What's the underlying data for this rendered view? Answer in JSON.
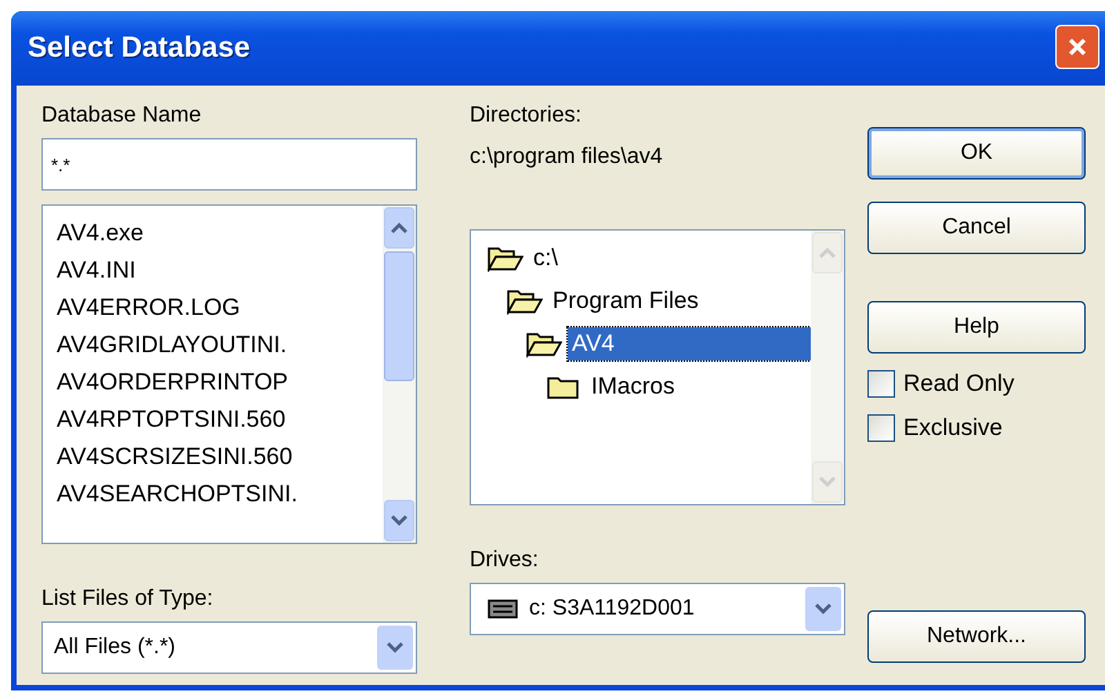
{
  "window": {
    "title": "Select Database"
  },
  "database_name": {
    "label": "Database Name",
    "value": "*.*"
  },
  "files": [
    "AV4.exe",
    "AV4.INI",
    "AV4ERROR.LOG",
    "AV4GRIDLAYOUTINI.",
    "AV4ORDERPRINTOP",
    "AV4RPTOPTSINI.560",
    "AV4SCRSIZESINI.560",
    "AV4SEARCHOPTSINI."
  ],
  "file_type": {
    "label": "List Files of Type:",
    "value": "All Files (*.*)"
  },
  "directories": {
    "label": "Directories:",
    "path": "c:\\program files\\av4",
    "tree": [
      {
        "label": "c:\\",
        "expanded": true,
        "selected": false,
        "children": [
          {
            "label": "Program Files",
            "expanded": true,
            "selected": false,
            "children": [
              {
                "label": "AV4",
                "expanded": true,
                "selected": true,
                "children": [
                  {
                    "label": "IMacros",
                    "expanded": false,
                    "selected": false
                  }
                ]
              }
            ]
          }
        ]
      }
    ]
  },
  "drives": {
    "label": "Drives:",
    "value": "c: S3A1192D001"
  },
  "buttons": [
    {
      "label": "OK",
      "default": true
    },
    {
      "label": "Cancel",
      "default": false
    },
    {
      "label": "Help",
      "default": false
    }
  ],
  "options": [
    {
      "label": "Read Only",
      "checked": false
    },
    {
      "label": "Exclusive",
      "checked": false
    }
  ],
  "network_button": "Network..."
}
